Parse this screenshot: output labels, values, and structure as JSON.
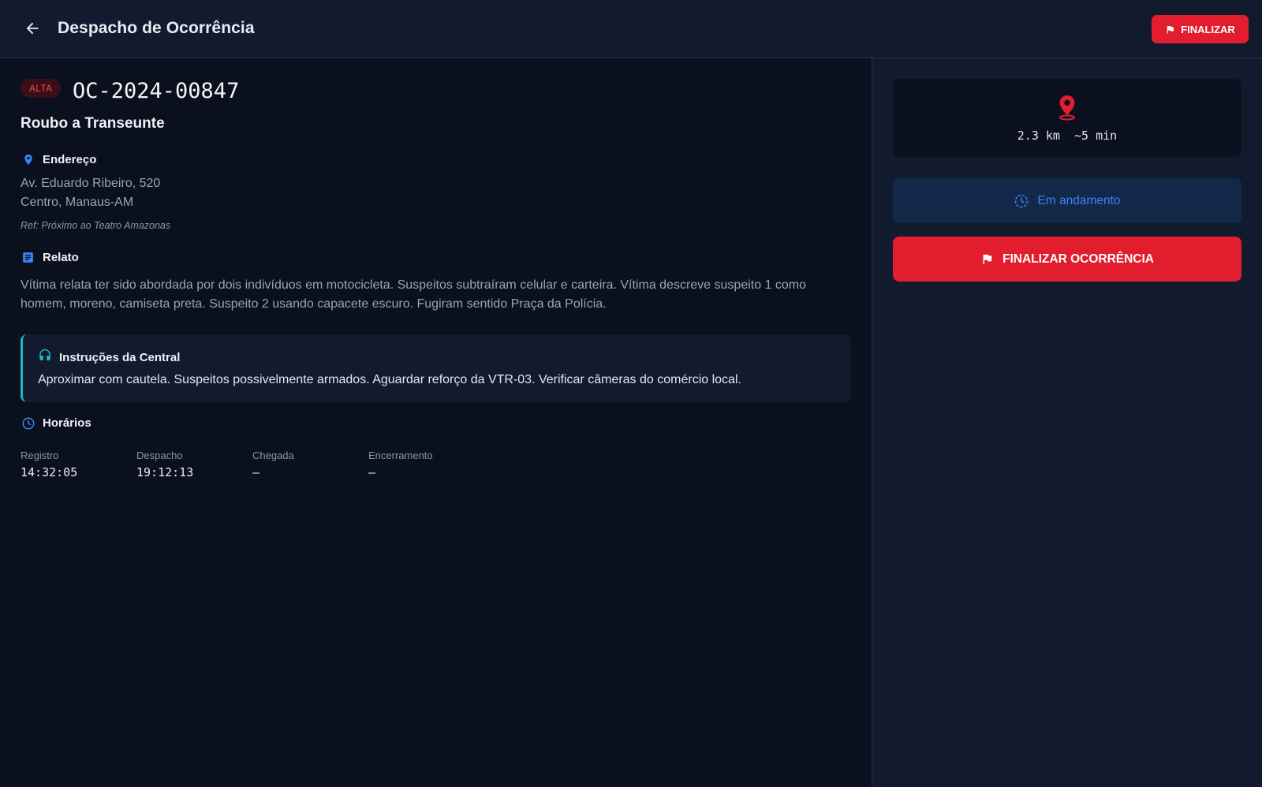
{
  "header": {
    "title": "Despacho de Ocorrência",
    "finalize_label": "FINALIZAR",
    "icons": {
      "back": "arrow-left-icon",
      "finalize": "flag-icon"
    }
  },
  "occurrence": {
    "priority": "ALTA",
    "id": "OC-2024-00847",
    "type": "Roubo a Transeunte"
  },
  "address": {
    "heading": "Endereço",
    "line1": "Av. Eduardo Ribeiro, 520",
    "line2": "Centro, Manaus-AM",
    "reference": "Ref: Próximo ao Teatro Amazonas"
  },
  "report": {
    "heading": "Relato",
    "text": "Vítima relata ter sido abordada por dois indivíduos em motocicleta. Suspeitos subtraíram celular e carteira. Vítima descreve suspeito 1 como homem, moreno, camiseta preta. Suspeito 2 usando capacete escuro. Fugiram sentido Praça da Polícia."
  },
  "instructions": {
    "heading": "Instruções da Central",
    "text": "Aproximar com cautela. Suspeitos possivelmente armados. Aguardar reforço da VTR-03. Verificar câmeras do comércio local."
  },
  "times": {
    "heading": "Horários",
    "items": [
      {
        "label": "Registro",
        "value": "14:32:05"
      },
      {
        "label": "Despacho",
        "value": "19:12:13"
      },
      {
        "label": "Chegada",
        "value": "–"
      },
      {
        "label": "Encerramento",
        "value": "–"
      }
    ]
  },
  "side": {
    "distance": "2.3 km  ~5 min",
    "status": "Em andamento",
    "finalize_label": "FINALIZAR OCORRÊNCIA"
  },
  "colors": {
    "accent_red": "#e11d2e",
    "accent_blue": "#3b82f6",
    "accent_cyan": "#1fb6c9",
    "background": "#0a101d",
    "panel": "#111b2d"
  }
}
